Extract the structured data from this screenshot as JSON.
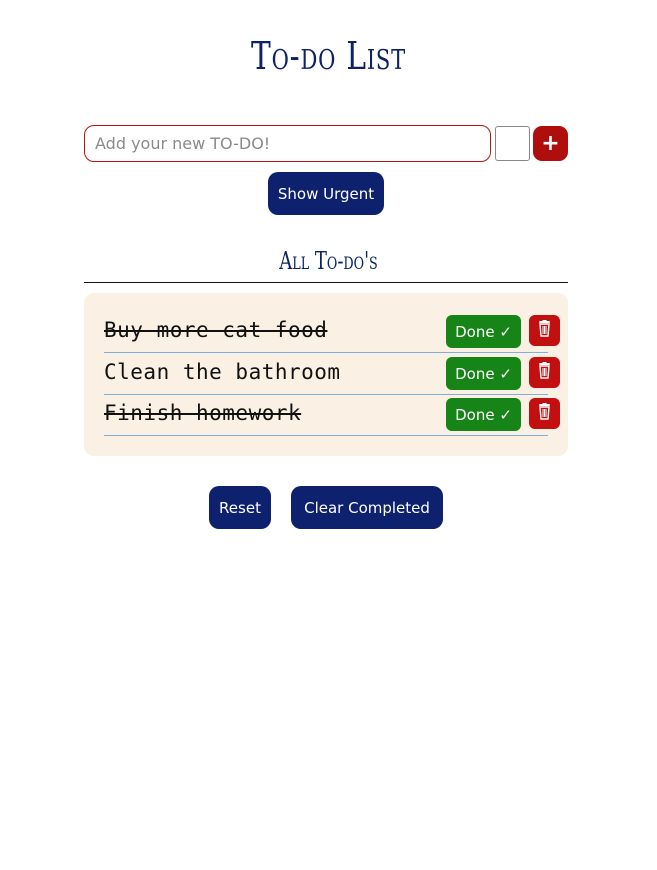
{
  "app": {
    "title": "To-do List"
  },
  "add_form": {
    "input_value": "",
    "input_placeholder": "Add your new TO-DO!",
    "urgent_checked": false,
    "add_label": "+"
  },
  "show_urgent_label": "Show Urgent",
  "list": {
    "title": "All To-do's",
    "items": [
      {
        "text": "Buy more cat food",
        "completed": true,
        "done_label": "Done ✓",
        "delete_icon": "trash-icon"
      },
      {
        "text": "Clean the bathroom",
        "completed": false,
        "done_label": "Done ✓",
        "delete_icon": "trash-icon"
      },
      {
        "text": "Finish homework",
        "completed": true,
        "done_label": "Done ✓",
        "delete_icon": "trash-icon"
      }
    ]
  },
  "footer": {
    "reset_label": "Reset",
    "clear_completed_label": "Clear Completed"
  },
  "colors": {
    "navy": "#0d216e",
    "red": "#b00d0d",
    "green": "#168416",
    "panel": "#faf0e4",
    "divider": "#7fb0da"
  }
}
